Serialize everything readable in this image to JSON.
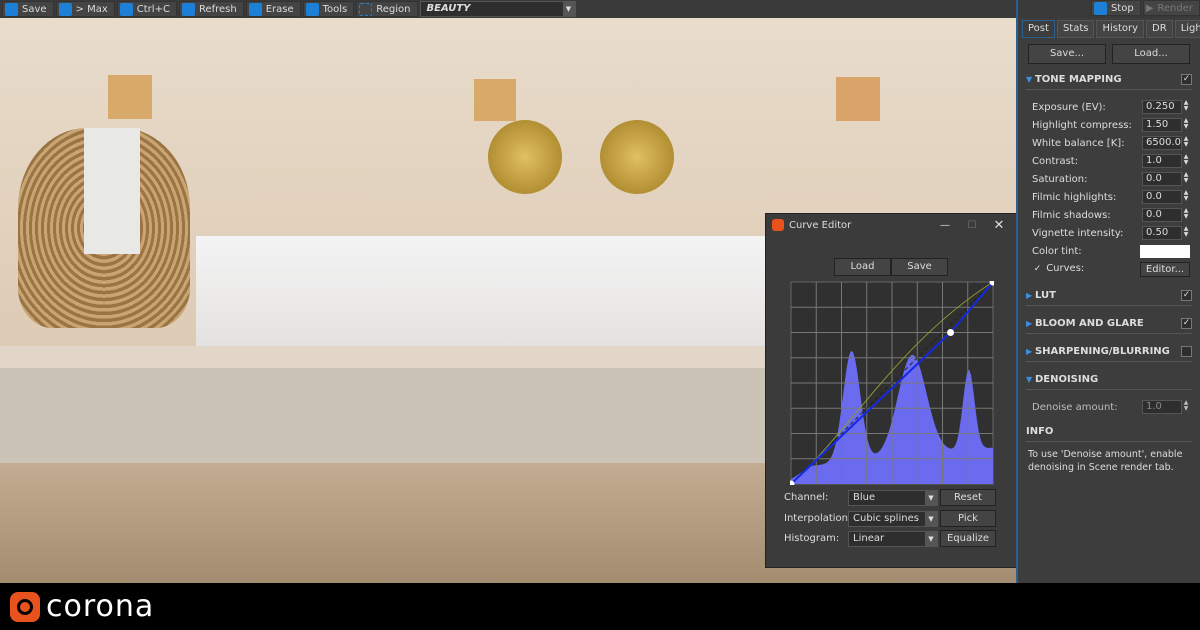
{
  "toolbar": {
    "items": [
      "Save",
      "> Max",
      "Ctrl+C",
      "Refresh",
      "Erase",
      "Tools",
      "Region"
    ],
    "channel": "BEAUTY"
  },
  "panel": {
    "stop": "Stop",
    "render": "Render",
    "tabs": [
      "Post",
      "Stats",
      "History",
      "DR",
      "LightMix"
    ],
    "save": "Save...",
    "load": "Load...",
    "tone_mapping": "TONE MAPPING",
    "fields": [
      [
        "Exposure (EV):",
        "0.250"
      ],
      [
        "Highlight compress:",
        "1.50"
      ],
      [
        "White balance [K]:",
        "6500.0"
      ],
      [
        "Contrast:",
        "1.0"
      ],
      [
        "Saturation:",
        "0.0"
      ],
      [
        "Filmic highlights:",
        "0.0"
      ],
      [
        "Filmic shadows:",
        "0.0"
      ],
      [
        "Vignette intensity:",
        "0.50"
      ]
    ],
    "color_tint": "Color tint:",
    "curves": "Curves:",
    "editor": "Editor...",
    "lut": "LUT",
    "bloom": "BLOOM AND GLARE",
    "sharpen": "SHARPENING/BLURRING",
    "denoising": "DENOISING",
    "denoise_amount": "Denoise amount:",
    "denoise_value": "1.0",
    "info": "INFO",
    "info_text": "To use 'Denoise amount', enable denoising in Scene render tab."
  },
  "curve_editor": {
    "title": "Curve Editor",
    "load": "Load",
    "save": "Save",
    "channel_label": "Channel:",
    "channel": "Blue",
    "interp_label": "Interpolation:",
    "interp": "Cubic splines",
    "hist_label": "Histogram:",
    "hist": "Linear",
    "reset": "Reset",
    "pick": "Pick",
    "equalize": "Equalize",
    "points": [
      [
        0,
        0
      ],
      [
        0.79,
        0.75
      ],
      [
        1,
        1
      ]
    ]
  },
  "brand": "corona"
}
